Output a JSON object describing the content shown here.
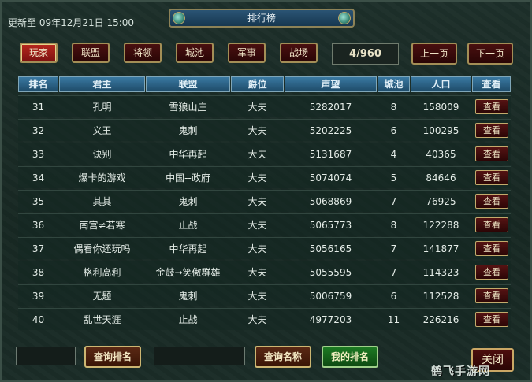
{
  "header": {
    "update_text": "更新至  09年12月21日  15:00",
    "title": "排行榜"
  },
  "tabs": [
    {
      "label": "玩家",
      "active": true
    },
    {
      "label": "联盟",
      "active": false
    },
    {
      "label": "将领",
      "active": false
    },
    {
      "label": "城池",
      "active": false
    },
    {
      "label": "军事",
      "active": false
    },
    {
      "label": "战场",
      "active": false
    }
  ],
  "pager": {
    "indicator": "4/960",
    "prev_label": "上一页",
    "next_label": "下一页"
  },
  "table": {
    "columns": [
      "排名",
      "君主",
      "联盟",
      "爵位",
      "声望",
      "城池",
      "人口",
      "查看"
    ],
    "view_label": "查看",
    "rows": [
      [
        "31",
        "孔明",
        "雪狼山庄",
        "大夫",
        "5282017",
        "8",
        "158009"
      ],
      [
        "32",
        "义王",
        "鬼刺",
        "大夫",
        "5202225",
        "6",
        "100295"
      ],
      [
        "33",
        "诀别",
        "中华再起",
        "大夫",
        "5131687",
        "4",
        "40365"
      ],
      [
        "34",
        "爆卡的游戏",
        "中国--政府",
        "大夫",
        "5074074",
        "5",
        "84646"
      ],
      [
        "35",
        "其其",
        "鬼刺",
        "大夫",
        "5068869",
        "7",
        "76925"
      ],
      [
        "36",
        "南宫≠若寒",
        "止战",
        "大夫",
        "5065773",
        "8",
        "122288"
      ],
      [
        "37",
        "偶看你还玩吗",
        "中华再起",
        "大夫",
        "5056165",
        "7",
        "141877"
      ],
      [
        "38",
        "格利高利",
        "金鼓→笑傲群雄",
        "大夫",
        "5055595",
        "7",
        "114323"
      ],
      [
        "39",
        "无题",
        "鬼刺",
        "大夫",
        "5006759",
        "6",
        "112528"
      ],
      [
        "40",
        "乱世天涯",
        "止战",
        "大夫",
        "4977203",
        "11",
        "226216"
      ]
    ]
  },
  "footer": {
    "rank_input_value": "",
    "query_rank_label": "查询排名",
    "name_input_value": "",
    "query_name_label": "查询名称",
    "my_rank_label": "我的排名",
    "close_label": "关闭"
  },
  "watermark": "鹤飞手游网"
}
